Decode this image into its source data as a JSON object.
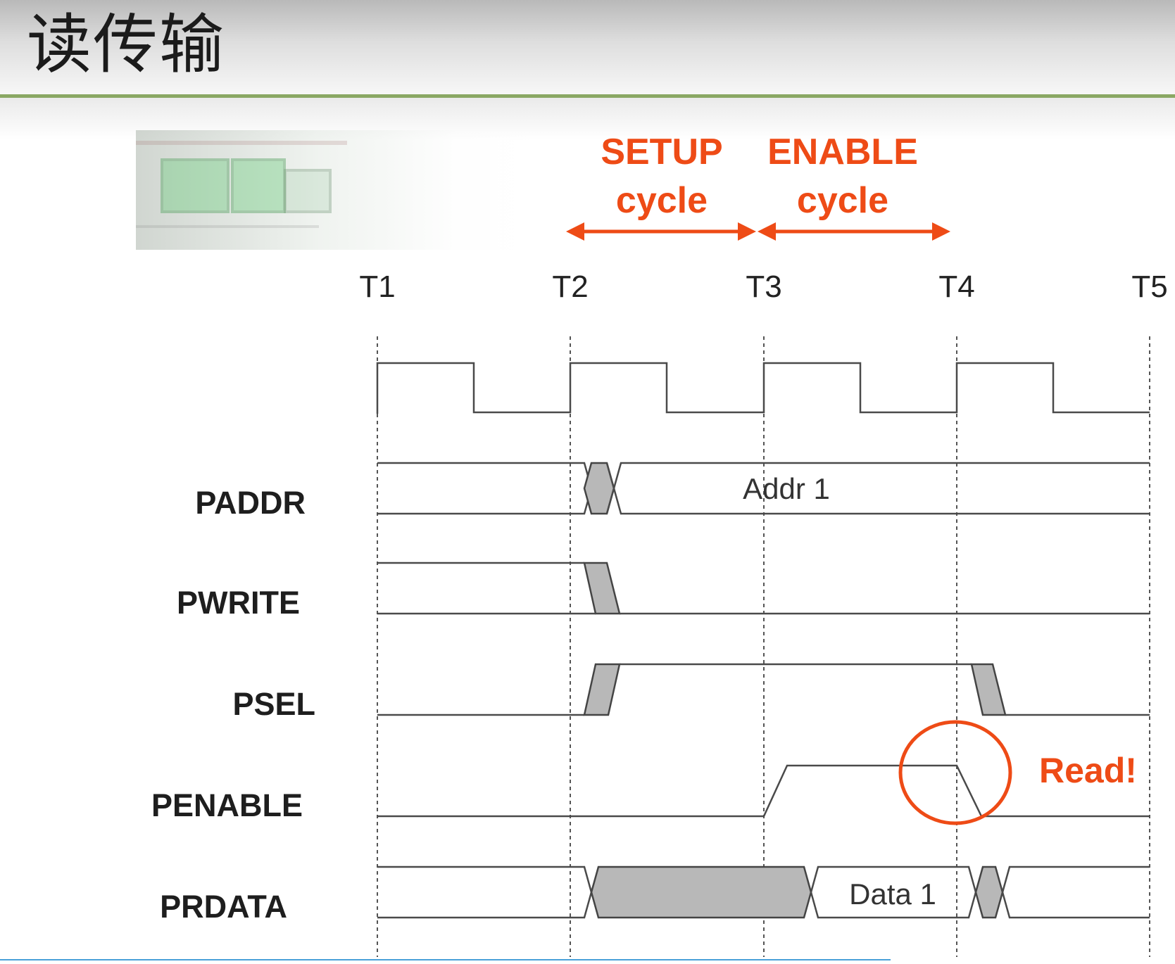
{
  "slide": {
    "title": "读传输"
  },
  "phases": {
    "setup_line1": "SETUP",
    "setup_line2": "cycle",
    "enable_line1": "ENABLE",
    "enable_line2": "cycle"
  },
  "clock_ticks": [
    "T1",
    "T2",
    "T3",
    "T4",
    "T5"
  ],
  "signals": [
    "PADDR",
    "PWRITE",
    "PSEL",
    "PENABLE",
    "PRDATA"
  ],
  "bus_values": {
    "paddr": "Addr 1",
    "prdata": "Data 1"
  },
  "annotation": {
    "read": "Read!"
  },
  "colors": {
    "accent": "#ee4b16",
    "header_rule": "#8aa864",
    "transition_fill": "#b8b8b8"
  }
}
